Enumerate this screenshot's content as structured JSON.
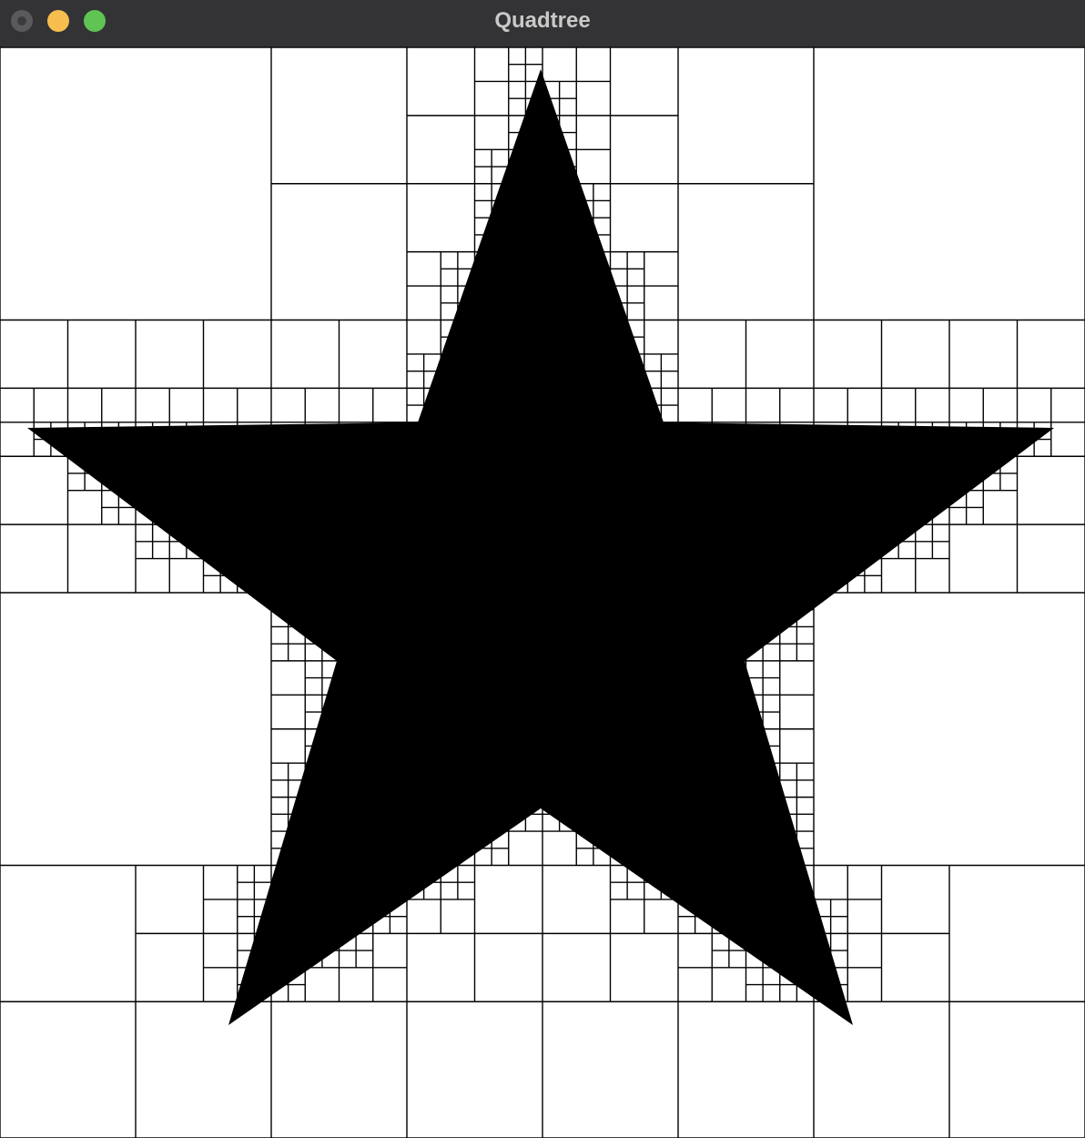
{
  "window": {
    "title": "Quadtree"
  },
  "colors": {
    "titlebar": "#333335",
    "title_text": "#c9c9c9",
    "close": "#5a5a5c",
    "minimize": "#f6be4f",
    "maximize": "#5fc454",
    "shape_fill": "#000000",
    "grid_line": "#000000",
    "background": "#ffffff"
  },
  "canvas": {
    "shape": "star",
    "icons": [
      "close-button",
      "minimize-button",
      "maximize-button"
    ]
  }
}
